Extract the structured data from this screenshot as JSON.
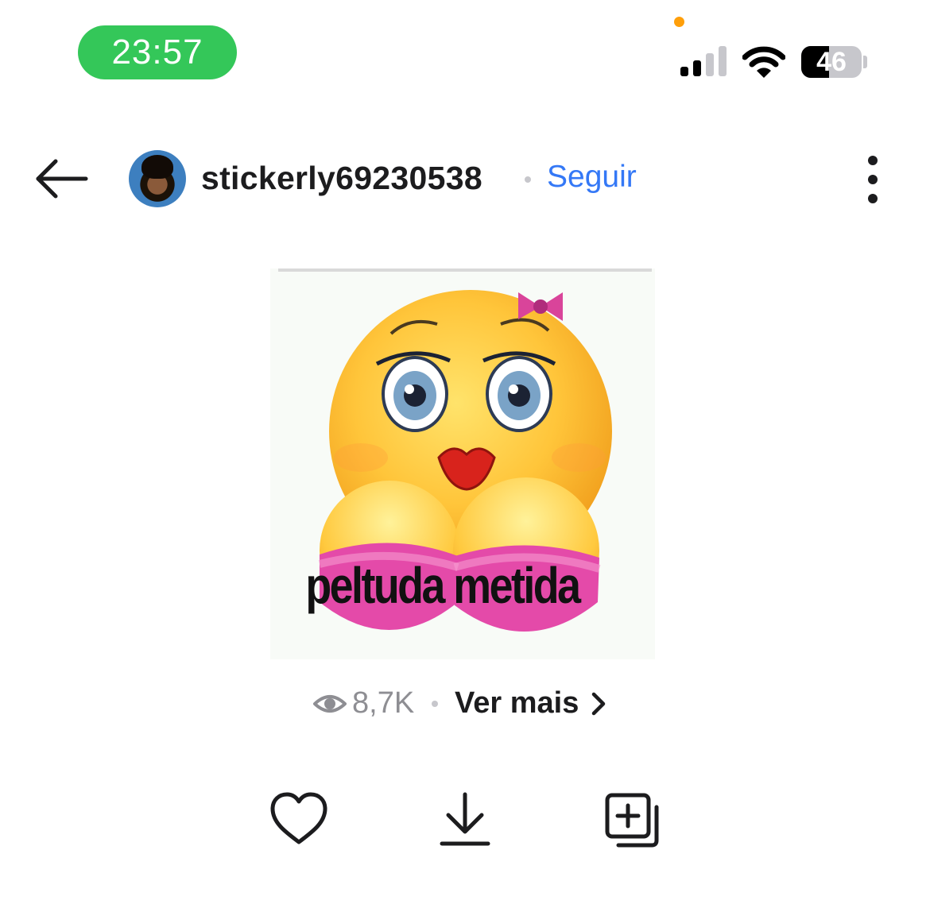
{
  "status_bar": {
    "time": "23:57",
    "battery_percent": "46",
    "battery_level": 0.46,
    "time_pill_color": "#34c759",
    "privacy_dot_color": "#ff9f0a"
  },
  "header": {
    "back_icon": "arrow-left-icon",
    "username": "stickerly69230538",
    "follow_label": "Seguir",
    "follow_color": "#3478f6",
    "more_icon": "vertical-ellipsis-icon"
  },
  "sticker": {
    "caption": "peltuda metida"
  },
  "stats": {
    "views_icon": "eye-icon",
    "views_count": "8,7K",
    "see_more_label": "Ver mais",
    "see_more_icon": "chevron-right-icon"
  },
  "actions": {
    "like_icon": "heart-icon",
    "download_icon": "download-icon",
    "add_icon": "add-to-collection-icon"
  }
}
